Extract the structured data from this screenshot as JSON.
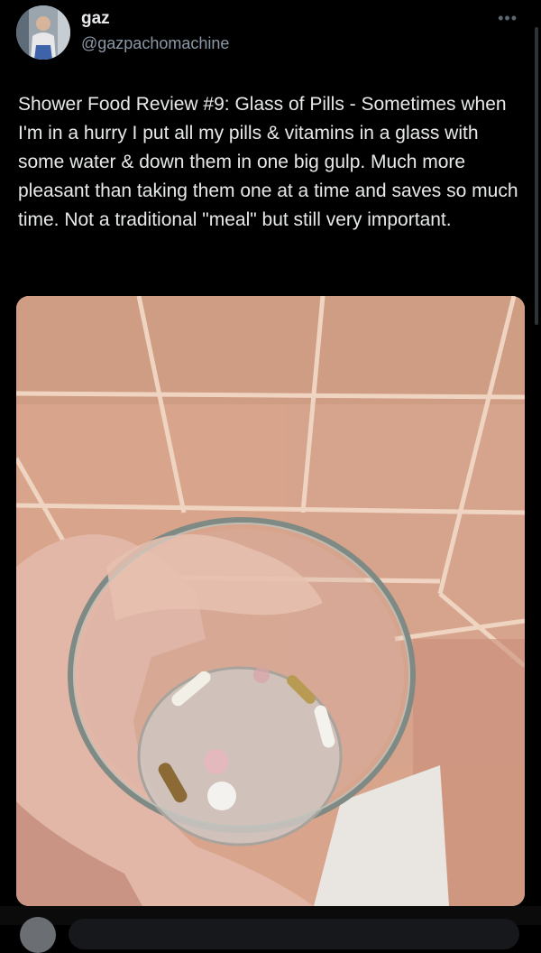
{
  "user": {
    "name": "gaz",
    "handle": "@gazpachomachine"
  },
  "more_menu": "•••",
  "tweet": {
    "text": "Shower Food Review #9: Glass of Pills - Sometimes when I'm in a hurry I put all my pills & vitamins in a glass with some water & down them in one big gulp. Much more pleasant than taking them one at a time and saves so much time. Not a traditional \"meal\" but still very important."
  },
  "icons": {
    "avatar": "profile-photo",
    "more": "more-options-icon"
  },
  "colors": {
    "background": "#000000",
    "text": "#e7e9ea",
    "secondary_text": "#8b98a5",
    "tile": "#d9a58c",
    "grout": "#eed3bf"
  }
}
